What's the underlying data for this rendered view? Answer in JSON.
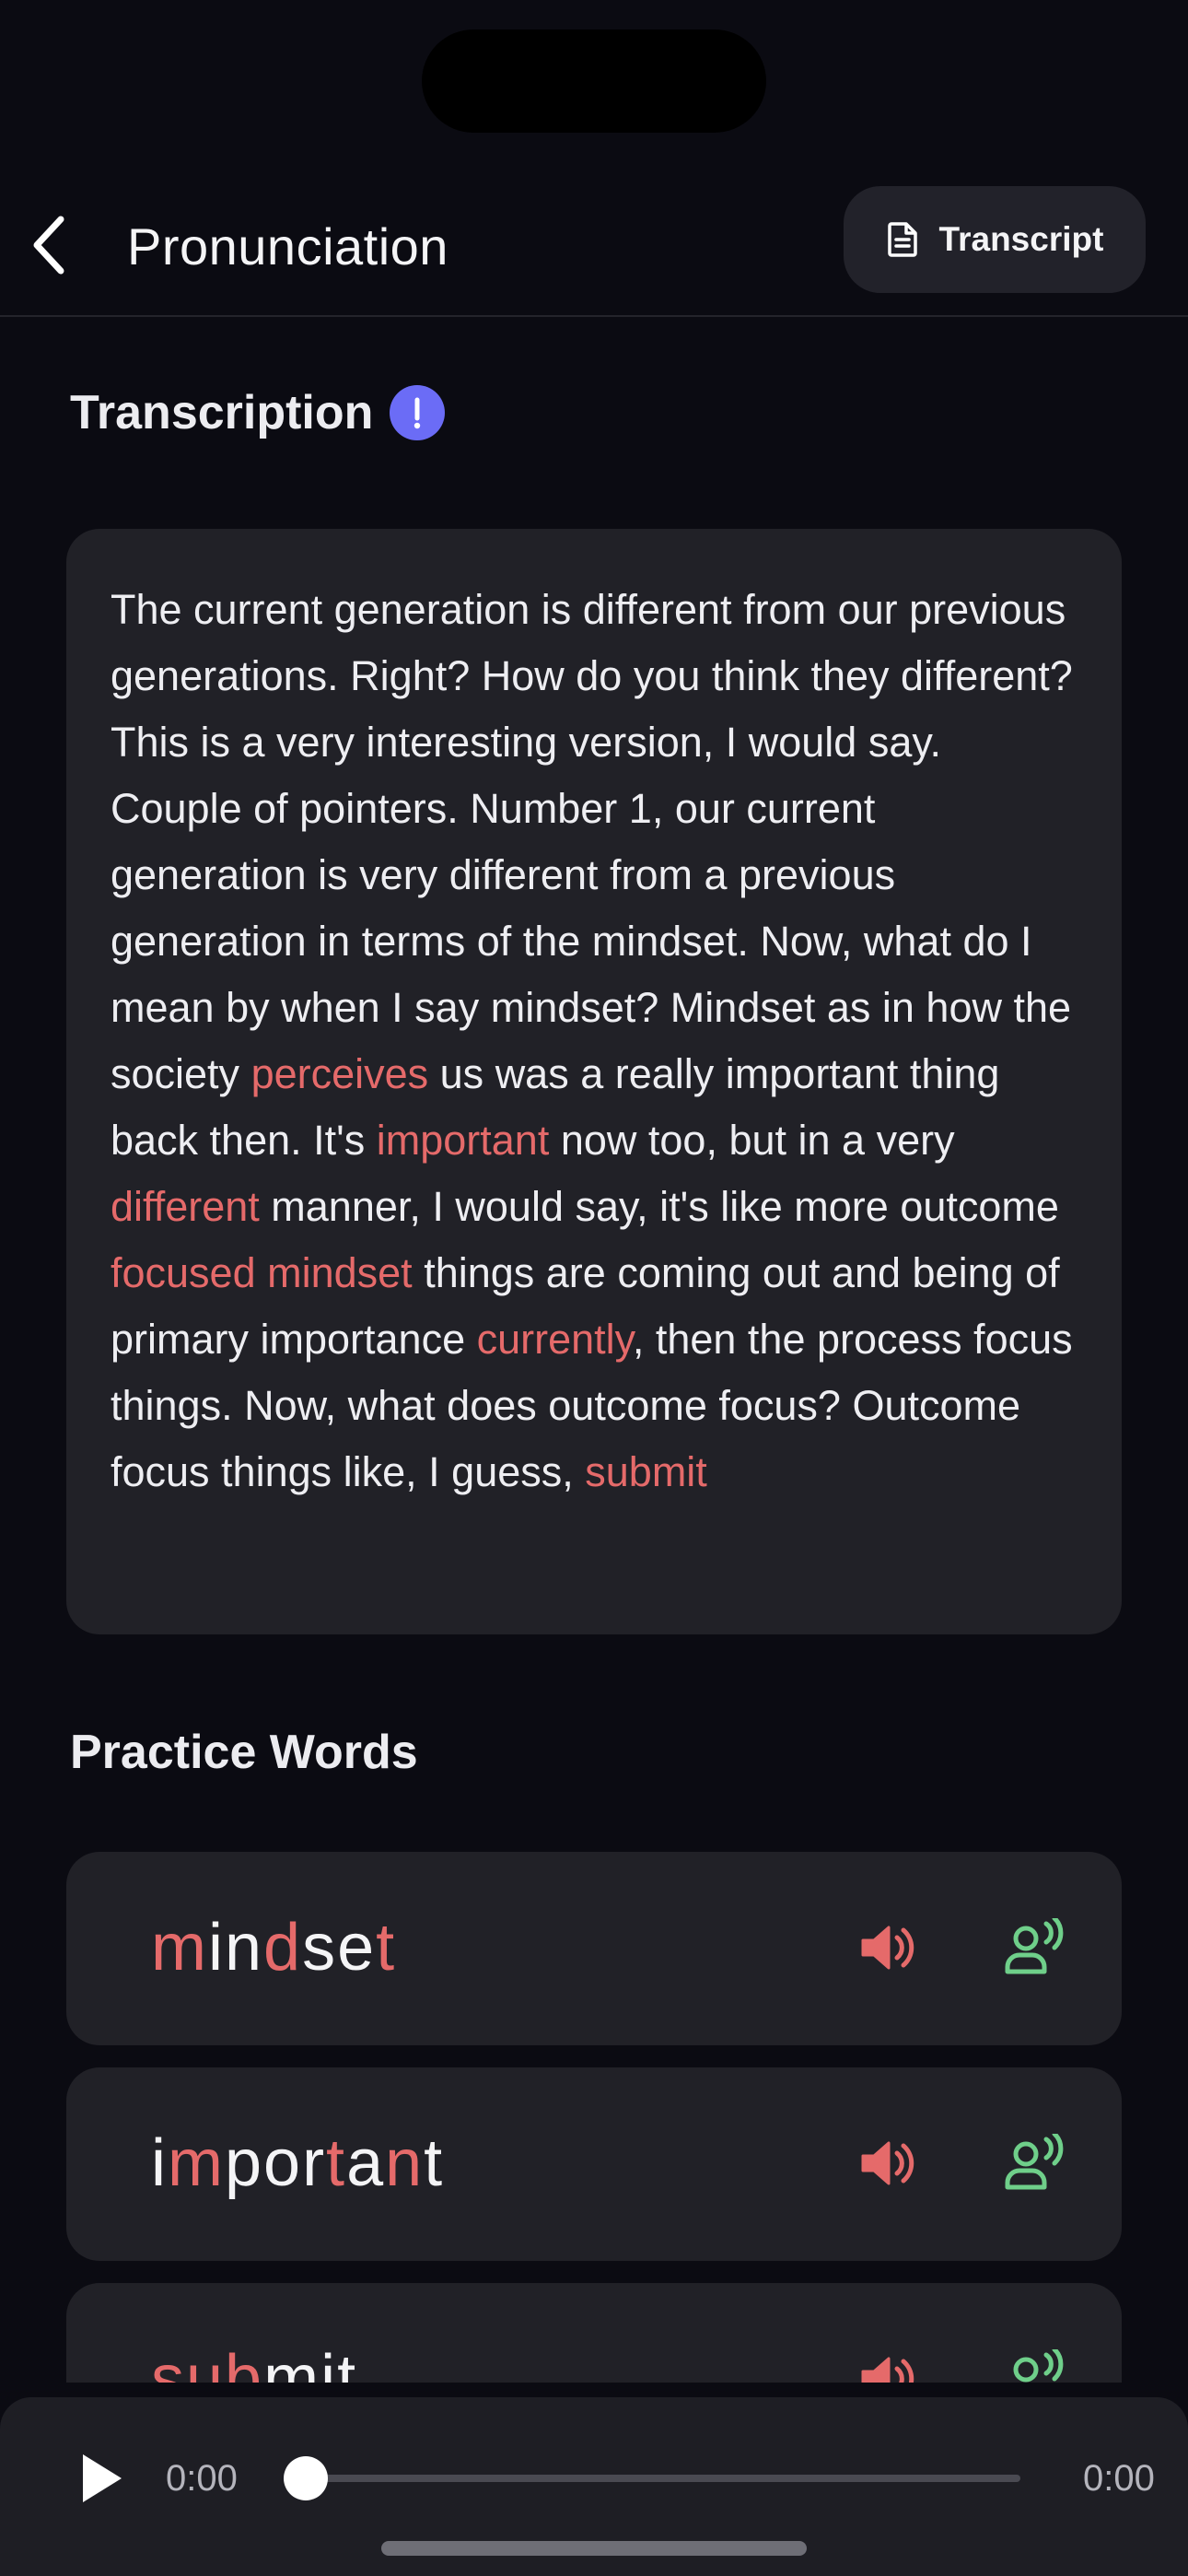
{
  "header": {
    "title": "Pronunciation",
    "transcript_label": "Transcript"
  },
  "transcription": {
    "heading": "Transcription",
    "info_icon": "exclamation-icon",
    "segments": [
      {
        "text": "The current generation is different from our previous generations. Right? How do you think they different? This is a very interesting version, I would say. Couple of pointers. Number 1, our current generation is very different from a previous generation in terms of the mindset. Now, what do I mean by when I say mindset? Mindset as in how the society ",
        "highlight": false
      },
      {
        "text": "perceives",
        "highlight": true
      },
      {
        "text": " us was a really important thing back then. It's ",
        "highlight": false
      },
      {
        "text": "important",
        "highlight": true
      },
      {
        "text": " now too, but in a very ",
        "highlight": false
      },
      {
        "text": "different",
        "highlight": true
      },
      {
        "text": " manner, I would say, it's like more outcome ",
        "highlight": false
      },
      {
        "text": "focused mindset",
        "highlight": true
      },
      {
        "text": " things are coming out and being of primary importance ",
        "highlight": false
      },
      {
        "text": "currently",
        "highlight": true
      },
      {
        "text": ", then the process focus things. Now, what does outcome focus? Outcome focus things like, I guess, ",
        "highlight": false
      },
      {
        "text": "submit",
        "highlight": true
      }
    ]
  },
  "practice": {
    "heading": "Practice Words",
    "words": [
      {
        "word": "mindset",
        "letters": [
          {
            "t": "m",
            "hl": true
          },
          {
            "t": "in",
            "hl": false
          },
          {
            "t": "d",
            "hl": true
          },
          {
            "t": "se",
            "hl": false
          },
          {
            "t": "t",
            "hl": true
          }
        ]
      },
      {
        "word": "important",
        "letters": [
          {
            "t": "i",
            "hl": false
          },
          {
            "t": "m",
            "hl": true
          },
          {
            "t": "por",
            "hl": false
          },
          {
            "t": "t",
            "hl": true
          },
          {
            "t": "a",
            "hl": false
          },
          {
            "t": "n",
            "hl": true
          },
          {
            "t": "t",
            "hl": false
          }
        ]
      },
      {
        "word": "submit",
        "letters": [
          {
            "t": "su",
            "hl": true
          },
          {
            "t": "b",
            "hl": true
          },
          {
            "t": "mit",
            "hl": false
          }
        ]
      }
    ],
    "speaker_icon": "speaker-icon",
    "mic_icon": "voice-record-icon"
  },
  "player": {
    "current_time": "0:00",
    "total_time": "0:00",
    "progress": 0
  },
  "colors": {
    "background": "#0b0b12",
    "card": "#212127",
    "highlight": "#e56a6a",
    "accent_green": "#6fcf8a",
    "info_badge": "#6b6cf6"
  }
}
